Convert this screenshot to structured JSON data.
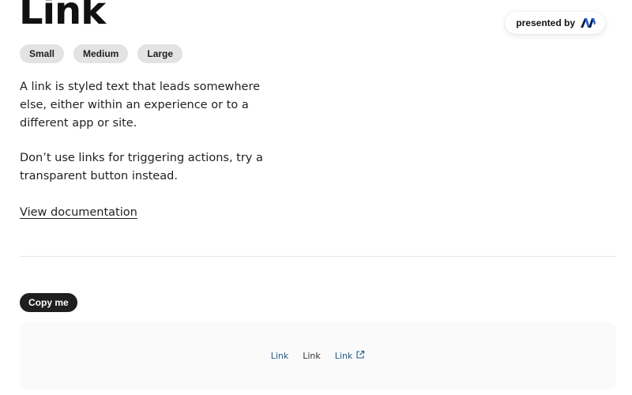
{
  "page": {
    "title": "Link",
    "presented_by_label": "presented by"
  },
  "sizes": [
    "Small",
    "Medium",
    "Large"
  ],
  "description": {
    "paragraph1": "A link is styled text that leads somewhere else, either within an experience or to a different app or site.",
    "paragraph2": "Don’t use links for triggering actions, try a transparent button instead."
  },
  "documentation_link": "View documentation",
  "copy_button": "Copy me",
  "preview": {
    "links": [
      "Link",
      "Link",
      "Link"
    ],
    "icons": {
      "external": "external-link-icon",
      "logo": "brand-logo-icon"
    }
  },
  "colors": {
    "link_accent": "#1e5a8a",
    "pill_bg": "#e3e3e3",
    "copy_button_bg": "#1f1f1f",
    "preview_bg": "#fafafa",
    "logo_dark": "#0b1a3a",
    "logo_blue": "#1e63e9"
  }
}
